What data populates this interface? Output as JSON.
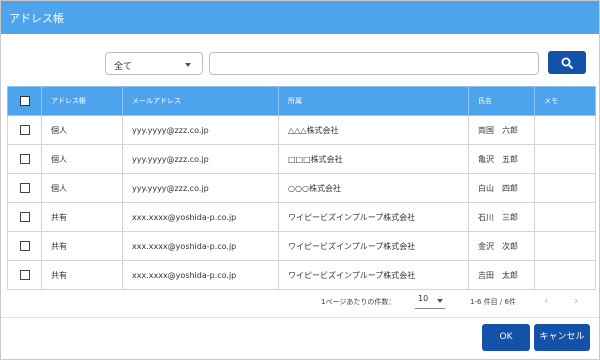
{
  "window": {
    "title": "アドレス帳"
  },
  "filter": {
    "selected": "全て"
  },
  "search": {
    "value": "",
    "icon": "search-icon"
  },
  "table": {
    "columns": [
      "アドレス帳",
      "メールアドレス",
      "所属",
      "氏名",
      "メモ"
    ],
    "rows": [
      {
        "book": "個人",
        "email": "yyy.yyyy@zzz.co.jp",
        "org": "△△△株式会社",
        "name": "両国　六郎",
        "memo": ""
      },
      {
        "book": "個人",
        "email": "yyy.yyyy@zzz.co.jp",
        "org": "□□□株式会社",
        "name": "亀沢　五郎",
        "memo": ""
      },
      {
        "book": "個人",
        "email": "yyy.yyyy@zzz.co.jp",
        "org": "○○○株式会社",
        "name": "白山　四郎",
        "memo": ""
      },
      {
        "book": "共有",
        "email": "xxx.xxxx@yoshida-p.co.jp",
        "org": "ワイピービズインプループ株式会社",
        "name": "石川　三郎",
        "memo": ""
      },
      {
        "book": "共有",
        "email": "xxx.xxxx@yoshida-p.co.jp",
        "org": "ワイピービズインプループ株式会社",
        "name": "金沢　次郎",
        "memo": ""
      },
      {
        "book": "共有",
        "email": "xxx.xxxx@yoshida-p.co.jp",
        "org": "ワイピービズインプループ株式会社",
        "name": "吉田　太郎",
        "memo": ""
      }
    ]
  },
  "pagination": {
    "per_page_label": "1ページあたりの件数：",
    "per_page": "10",
    "range": "1-6 件目 / 6件",
    "prev": "‹",
    "next": "›"
  },
  "footer": {
    "ok_label": "OK",
    "cancel_label": "キャンセル"
  }
}
